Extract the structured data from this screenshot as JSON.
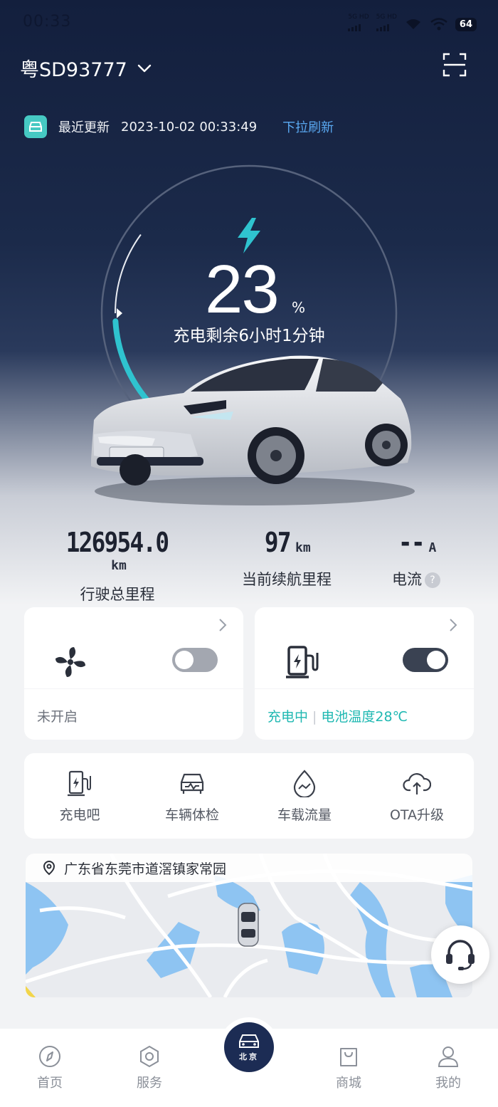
{
  "status_bar": {
    "time": "00:33",
    "sim1": "5G HD",
    "sim2": "5G HD",
    "battery": "64"
  },
  "header": {
    "plate": "粤SD93777",
    "dropdown_icon": "chevron-down-icon",
    "scan_icon": "scan-icon"
  },
  "update": {
    "label": "最近更新",
    "time": "2023-10-02 00:33:49",
    "refresh": "下拉刷新"
  },
  "charge": {
    "percent": "23",
    "percent_sign": "%",
    "percent_value": 0.23,
    "remaining": "充电剩余6小时1分钟",
    "accent": "#2fc3cf"
  },
  "stats": [
    {
      "value": "126954.0",
      "unit": "km",
      "label": "行驶总里程"
    },
    {
      "value": "97",
      "unit": "km",
      "label": "当前续航里程"
    },
    {
      "value": "--",
      "unit": "A",
      "label": "电流",
      "help": "?"
    }
  ],
  "climate_card": {
    "icon": "fan-icon",
    "status": "未开启",
    "toggle_on": false
  },
  "charge_card": {
    "icon": "charging-station-icon",
    "status": "充电中",
    "temp": "电池温度28℃",
    "toggle_on": true,
    "status_color": "#1fb8b2"
  },
  "services": [
    {
      "label": "充电吧",
      "icon": "charger-icon"
    },
    {
      "label": "车辆体检",
      "icon": "car-check-icon"
    },
    {
      "label": "车载流量",
      "icon": "data-drop-icon"
    },
    {
      "label": "OTA升级",
      "icon": "cloud-upload-icon"
    }
  ],
  "map": {
    "address": "广东省东莞市道滘镇家常园",
    "icon": "location-pin-icon"
  },
  "tabs": [
    {
      "label": "首页",
      "icon": "compass-icon"
    },
    {
      "label": "服务",
      "icon": "hexagon-icon"
    },
    {
      "label": "北京",
      "icon": "brand-car-icon"
    },
    {
      "label": "商城",
      "icon": "shopping-bag-icon"
    },
    {
      "label": "我的",
      "icon": "user-icon"
    }
  ],
  "support_icon": "headset-icon"
}
